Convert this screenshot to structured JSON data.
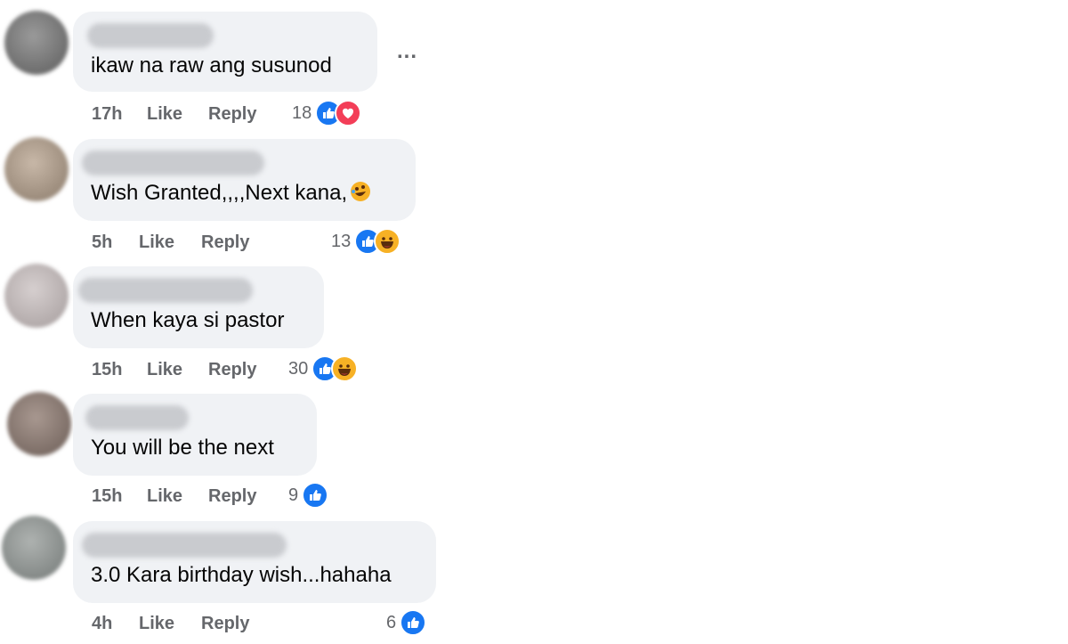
{
  "more_menu_label": "...",
  "comments": [
    {
      "text": "ikaw na raw ang susunod",
      "time": "17h",
      "like_label": "Like",
      "reply_label": "Reply",
      "reaction_count": "18",
      "reactions": [
        "like-icon",
        "love-icon"
      ]
    },
    {
      "text": "Wish Granted,,,,Next kana,",
      "time": "5h",
      "like_label": "Like",
      "reply_label": "Reply",
      "reaction_count": "13",
      "reactions": [
        "like-icon",
        "haha-icon"
      ]
    },
    {
      "text": "When kaya si pastor",
      "time": "15h",
      "like_label": "Like",
      "reply_label": "Reply",
      "reaction_count": "30",
      "reactions": [
        "like-icon",
        "haha-icon"
      ]
    },
    {
      "text": "You will be the next",
      "time": "15h",
      "like_label": "Like",
      "reply_label": "Reply",
      "reaction_count": "9",
      "reactions": [
        "like-icon"
      ]
    },
    {
      "text": "3.0 Kara birthday wish...hahaha",
      "time": "4h",
      "like_label": "Like",
      "reply_label": "Reply",
      "reaction_count": "6",
      "reactions": [
        "like-icon"
      ]
    }
  ],
  "colors": {
    "like": "#1877f2",
    "love": "#f33e58",
    "haha": "#f7b125",
    "bubble": "#f0f2f5",
    "meta": "#65676b"
  }
}
